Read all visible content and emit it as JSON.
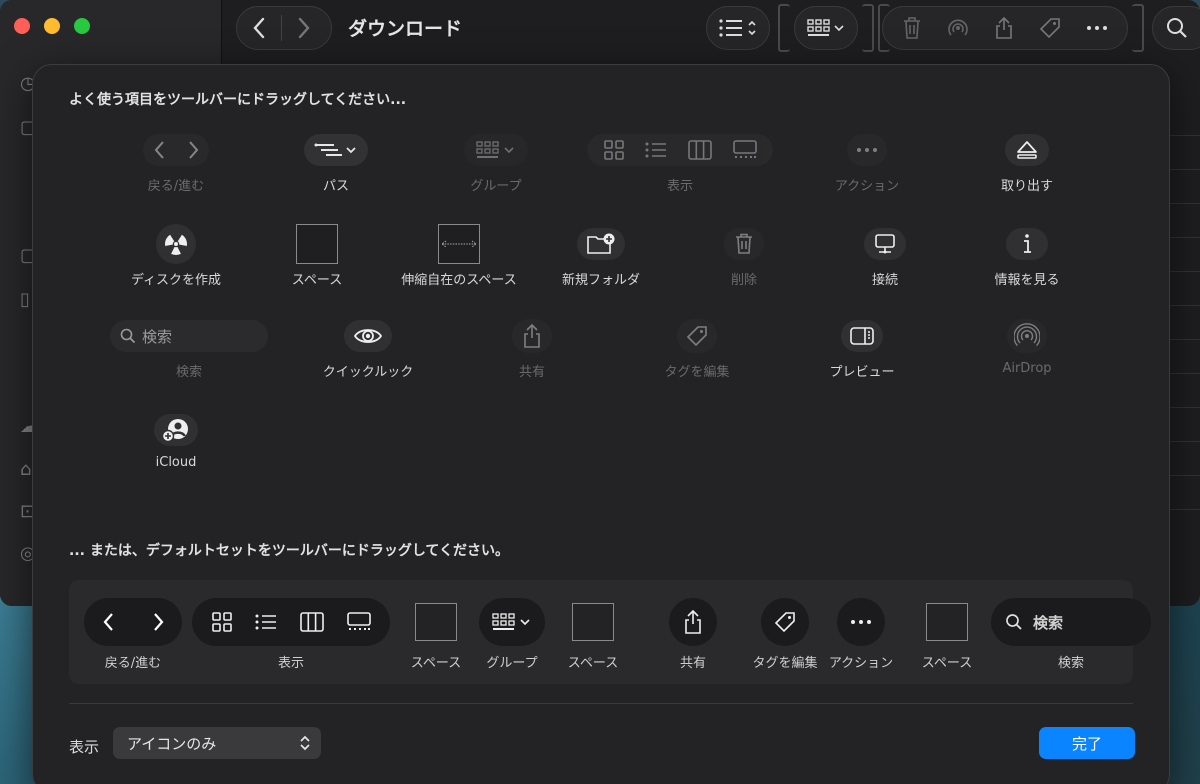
{
  "window": {
    "title": "ダウンロード"
  },
  "sheet": {
    "header_top": "よく使う項目をツールバーにドラッグしてください...",
    "header_default": "... または、デフォルトセットをツールバーにドラッグしてください。",
    "items": [
      {
        "label": "戻る/進む"
      },
      {
        "label": "パス"
      },
      {
        "label": "グループ"
      },
      {
        "label": "表示"
      },
      {
        "label": "アクション"
      },
      {
        "label": "取り出す"
      },
      {
        "label": "ディスクを作成"
      },
      {
        "label": "スペース"
      },
      {
        "label": "伸縮自在のスペース"
      },
      {
        "label": "新規フォルダ"
      },
      {
        "label": "削除"
      },
      {
        "label": "接続"
      },
      {
        "label": "情報を見る"
      },
      {
        "label": "検索",
        "field_text": "検索"
      },
      {
        "label": "クイックルック"
      },
      {
        "label": "共有"
      },
      {
        "label": "タグを編集"
      },
      {
        "label": "プレビュー"
      },
      {
        "label": "AirDrop"
      },
      {
        "label": "iCloud"
      }
    ],
    "default_set": [
      {
        "label": "戻る/進む"
      },
      {
        "label": "表示"
      },
      {
        "label": "スペース"
      },
      {
        "label": "グループ"
      },
      {
        "label": "スペース"
      },
      {
        "label": "共有"
      },
      {
        "label": "タグを編集"
      },
      {
        "label": "アクション"
      },
      {
        "label": "スペース"
      },
      {
        "label": "検索",
        "field_text": "検索"
      }
    ],
    "show_label": "表示",
    "show_value": "アイコンのみ",
    "done_label": "完了"
  },
  "colors": {
    "accent": "#0a84ff",
    "sheet_bg": "#232325",
    "text": "#dcdcdc",
    "dim_text": "#6a6a6c"
  }
}
